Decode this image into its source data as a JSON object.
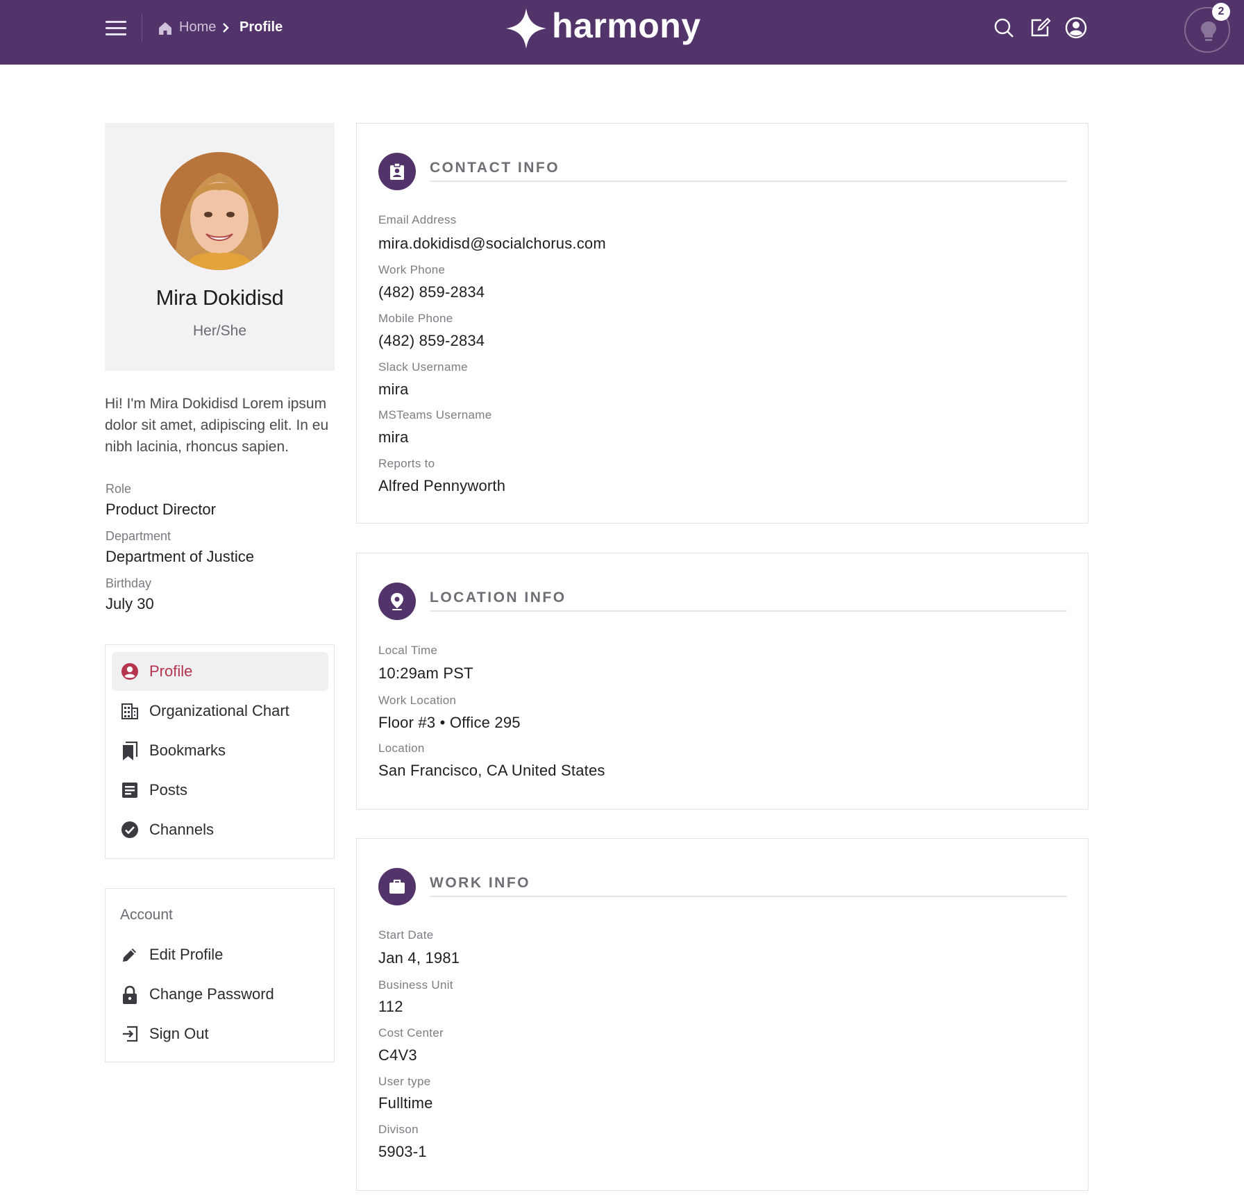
{
  "header": {
    "breadcrumb": {
      "home": "Home",
      "current": "Profile"
    },
    "logo_text": "harmony",
    "notification_count": "2",
    "icons": [
      "menu-icon",
      "home-icon",
      "chevron-right-icon",
      "search-icon",
      "compose-icon",
      "user-icon",
      "lightbulb-icon"
    ],
    "colors": {
      "brand": "#52346a",
      "accent": "#b5344e"
    }
  },
  "profile": {
    "name": "Mira Dokidisd",
    "pronouns": "Her/She",
    "bio": "Hi! I'm Mira Dokidisd Lorem ipsum dolor sit amet, adipiscing elit. In eu nibh lacinia, rhoncus sapien.",
    "role_label": "Role",
    "role": "Product Director",
    "department_label": "Department",
    "department": "Department of Justice",
    "birthday_label": "Birthday",
    "birthday": "July 30"
  },
  "nav": {
    "items": [
      {
        "label": "Profile",
        "icon": "user-circle-icon",
        "active": true
      },
      {
        "label": "Organizational Chart",
        "icon": "building-icon"
      },
      {
        "label": "Bookmarks",
        "icon": "bookmark-icon"
      },
      {
        "label": "Posts",
        "icon": "document-icon"
      },
      {
        "label": "Channels",
        "icon": "check-circle-icon"
      }
    ]
  },
  "account": {
    "title": "Account",
    "items": [
      {
        "label": "Edit Profile",
        "icon": "pencil-icon"
      },
      {
        "label": "Change Password",
        "icon": "lock-icon"
      },
      {
        "label": "Sign Out",
        "icon": "sign-out-icon"
      }
    ]
  },
  "contact": {
    "title": "CONTACT INFO",
    "fields": [
      {
        "label": "Email Address",
        "value": "mira.dokidisd@socialchorus.com"
      },
      {
        "label": "Work Phone",
        "value": "(482) 859-2834"
      },
      {
        "label": "Mobile Phone",
        "value": "(482) 859-2834"
      },
      {
        "label": "Slack Username",
        "value": "mira"
      },
      {
        "label": "MSTeams Username",
        "value": "mira"
      },
      {
        "label": "Reports to",
        "value": "Alfred Pennyworth"
      }
    ]
  },
  "location": {
    "title": "LOCATION INFO",
    "fields": [
      {
        "label": "Local Time",
        "value": "10:29am PST"
      },
      {
        "label": "Work Location",
        "value": "Floor #3 • Office 295"
      },
      {
        "label": "Location",
        "value": "San Francisco, CA United States"
      }
    ]
  },
  "work": {
    "title": "WORK INFO",
    "fields": [
      {
        "label": "Start Date",
        "value": "Jan 4, 1981"
      },
      {
        "label": "Business Unit",
        "value": "112"
      },
      {
        "label": "Cost Center",
        "value": "C4V3"
      },
      {
        "label": "User type",
        "value": "Fulltime"
      },
      {
        "label": "Divison",
        "value": "5903-1"
      }
    ]
  }
}
